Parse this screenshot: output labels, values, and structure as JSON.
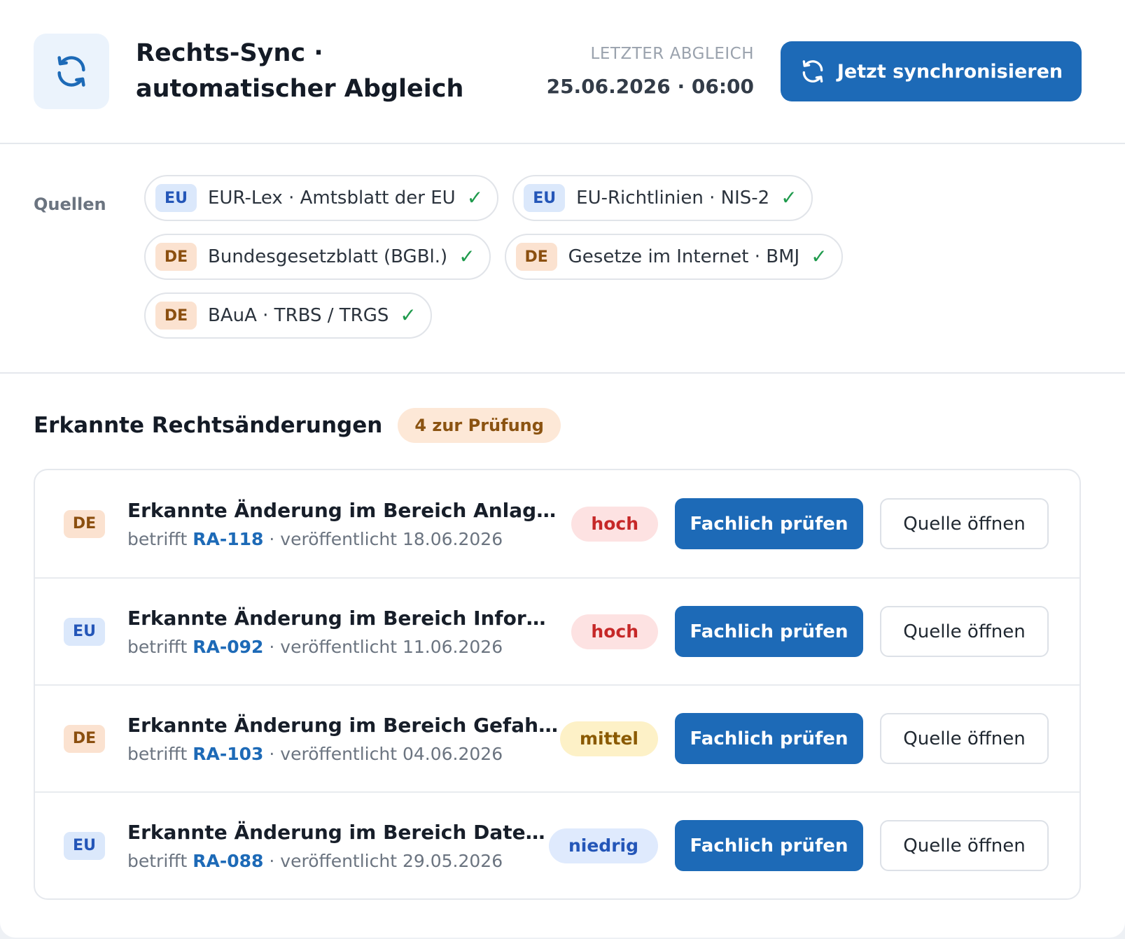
{
  "header": {
    "title": "Rechts-Sync · automatischer Abgleich",
    "icon": "sync-icon",
    "last_sync_label": "LETZTER ABGLEICH",
    "last_sync_value": "25.06.2026 · 06:00",
    "sync_button_label": "Jetzt synchronisieren",
    "accent_color": "#1d6ab7"
  },
  "sources": {
    "label": "Quellen",
    "items": [
      {
        "region": "EU",
        "label": "EUR-Lex · Amtsblatt der EU",
        "status_icon": "check-icon"
      },
      {
        "region": "EU",
        "label": "EU-Richtlinien · NIS-2",
        "status_icon": "check-icon"
      },
      {
        "region": "DE",
        "label": "Bundesgesetzblatt (BGBl.)",
        "status_icon": "check-icon"
      },
      {
        "region": "DE",
        "label": "Gesetze im Internet · BMJ",
        "status_icon": "check-icon"
      },
      {
        "region": "DE",
        "label": "BAuA · TRBS / TRGS",
        "status_icon": "check-icon"
      }
    ]
  },
  "changes": {
    "title": "Erkannte Rechtsänderungen",
    "badge": "4 zur Prüfung",
    "items": [
      {
        "region": "DE",
        "title": "Erkannte Änderung im Bereich Anlagensi...",
        "prefix": "betrifft",
        "ref": "RA-118",
        "published": "· veröffentlicht 18.06.2026",
        "priority": "hoch",
        "primary_action": "Fachlich prüfen",
        "secondary_action": "Quelle öffnen"
      },
      {
        "region": "EU",
        "title": "Erkannte Änderung im Bereich Informati...",
        "prefix": "betrifft",
        "ref": "RA-092",
        "published": "· veröffentlicht 11.06.2026",
        "priority": "hoch",
        "primary_action": "Fachlich prüfen",
        "secondary_action": "Quelle öffnen"
      },
      {
        "region": "DE",
        "title": "Erkannte Änderung im Bereich Gefahrst...",
        "prefix": "betrifft",
        "ref": "RA-103",
        "published": "· veröffentlicht 04.06.2026",
        "priority": "mittel",
        "primary_action": "Fachlich prüfen",
        "secondary_action": "Quelle öffnen"
      },
      {
        "region": "EU",
        "title": "Erkannte Änderung im Bereich Datensc...",
        "prefix": "betrifft",
        "ref": "RA-088",
        "published": "· veröffentlicht 29.05.2026",
        "priority": "niedrig",
        "primary_action": "Fachlich prüfen",
        "secondary_action": "Quelle öffnen"
      }
    ]
  }
}
